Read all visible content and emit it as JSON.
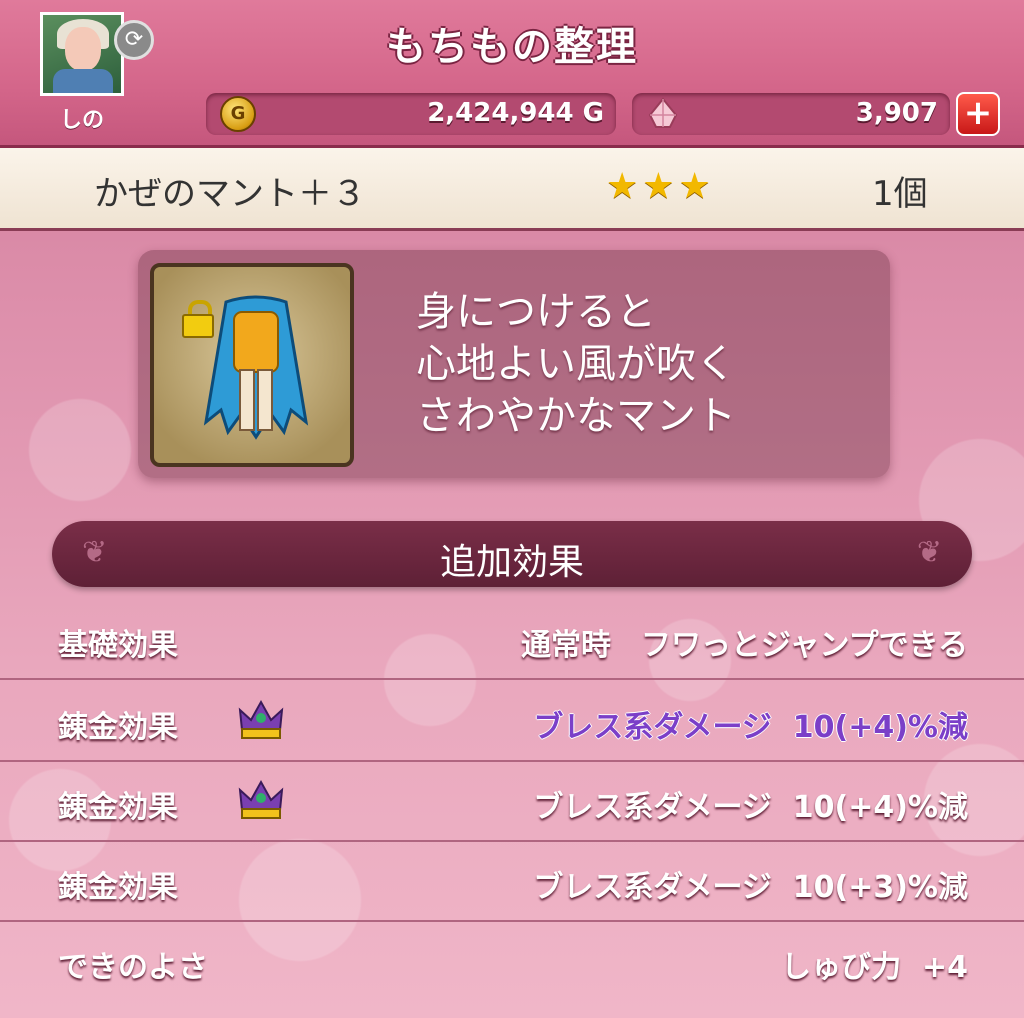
{
  "header": {
    "title": "もちもの整理",
    "character_name": "しの",
    "gold": "2,424,944 G",
    "gold_icon_letter": "G",
    "gems": "3,907",
    "plus_label": "+"
  },
  "item": {
    "name": "かぜのマント＋３",
    "stars": "★★★",
    "star_count": 3,
    "count": "1個",
    "locked": true,
    "description_lines": [
      "身につけると",
      "心地よい風が吹く",
      "さわやかなマント"
    ]
  },
  "section": {
    "title": "追加効果"
  },
  "effects": [
    {
      "label": "基礎効果",
      "value": "通常時　フワっとジャンプできる",
      "crown": false,
      "highlight": false
    },
    {
      "label": "錬金効果",
      "value": "ブレス系ダメージ  10(+4)%減",
      "crown": true,
      "highlight": true
    },
    {
      "label": "錬金効果",
      "value": "ブレス系ダメージ  10(+4)%減",
      "crown": true,
      "highlight": false
    },
    {
      "label": "錬金効果",
      "value": "ブレス系ダメージ  10(+3)%減",
      "crown": false,
      "highlight": false
    },
    {
      "label": "できのよさ",
      "value": "しゅび力  +4",
      "crown": false,
      "highlight": false
    }
  ],
  "colors": {
    "header": "#d4668a",
    "highlight_text": "#7b3fc8",
    "section_bar": "#6a2640"
  }
}
